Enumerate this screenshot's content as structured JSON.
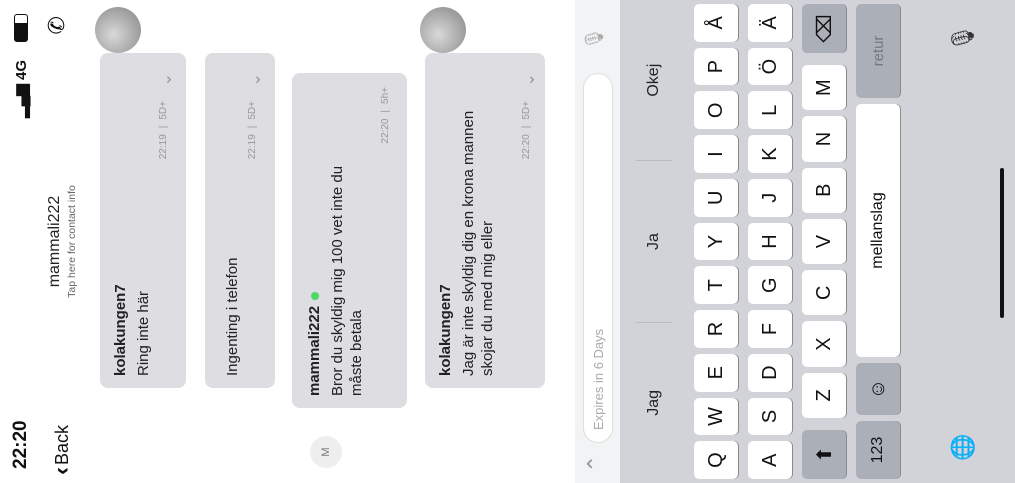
{
  "status": {
    "time": "22:20",
    "network": "4G"
  },
  "header": {
    "back_label": "Back",
    "title": "mammali222",
    "subtitle": "Tap here for contact info"
  },
  "messages": [
    {
      "sender": "kolakungen7",
      "text": "Ring inte här",
      "time": "22:19",
      "status": "5D+"
    },
    {
      "text": "Ingenting i telefon",
      "time": "22:19",
      "status": "5D+"
    },
    {
      "sender": "mammali222",
      "avatar_letter": "M",
      "text": "Bror du skyldig mig 100 vet inte du måste betala",
      "time": "22:20",
      "status": "5h+"
    },
    {
      "sender": "kolakungen7",
      "text": "Jag är inte skyldig dig en krona mannen skojar du med mig eller",
      "time": "22:20",
      "status": "5D+"
    }
  ],
  "composer": {
    "placeholder": "Expires in 6 Days"
  },
  "suggestions": [
    "Jag",
    "Ja",
    "Okej"
  ],
  "keyboard": {
    "row1": [
      "Q",
      "W",
      "E",
      "R",
      "T",
      "Y",
      "U",
      "I",
      "O",
      "P",
      "Å"
    ],
    "row2": [
      "A",
      "S",
      "D",
      "F",
      "G",
      "H",
      "J",
      "K",
      "L",
      "Ö",
      "Ä"
    ],
    "row3": [
      "Z",
      "X",
      "C",
      "V",
      "B",
      "N",
      "M"
    ],
    "numbers_label": "123",
    "space_label": "mellanslag",
    "return_label": "retur"
  },
  "colors": {
    "bubble": "#dddde2",
    "keyboard_bg": "#d1d3d9",
    "online": "#4cd964"
  }
}
